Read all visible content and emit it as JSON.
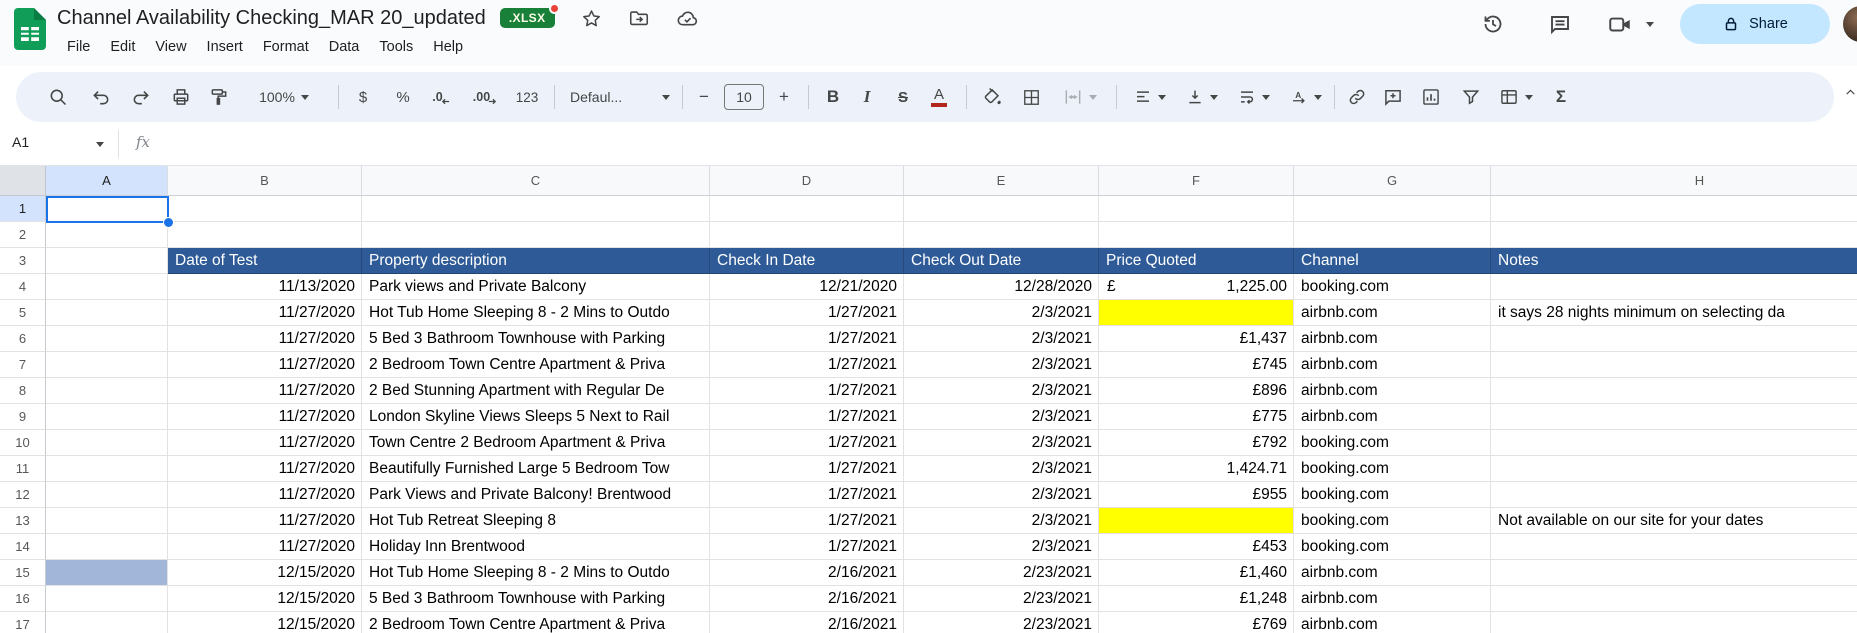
{
  "app": {
    "title": "Channel Availability Checking_MAR 20_updated",
    "file_badge": ".XLSX",
    "menu_items": [
      "File",
      "Edit",
      "View",
      "Insert",
      "Format",
      "Data",
      "Tools",
      "Help"
    ],
    "share_button": "Share"
  },
  "toolbar": {
    "zoom_value": "100%",
    "currency_label": "$",
    "percent_label": "%",
    "decimal_decrease_label": ".0",
    "decimal_increase_label": ".00",
    "plain_format_label": "123",
    "font_family_value": "Defaul...",
    "minus_label": "−",
    "font_size_value": "10",
    "plus_label": "+",
    "bold_label": "B",
    "italic_label": "I",
    "strikethrough_label": "S",
    "text_color_label": "A",
    "functions_label": "Σ",
    "collapse_label": "^"
  },
  "formula_bar": {
    "cell_reference": "A1",
    "fx_label": "fx"
  },
  "grid": {
    "column_letters": [
      "A",
      "B",
      "C",
      "D",
      "E",
      "F",
      "G",
      "H"
    ],
    "selected_cell": "A1",
    "selected_column": "A",
    "selected_row": 1,
    "visible_row_count": 17
  },
  "sheet_table": {
    "header_row_number": 3,
    "headers_by_col": {
      "B": "Date of Test",
      "C": "Property description",
      "D": "Check In Date",
      "E": "Check Out Date",
      "F": "Price Quoted",
      "G": "Channel",
      "H": "Notes"
    },
    "rows": [
      {
        "n": 4,
        "date": "11/13/2020",
        "property": "Park views and Private Balcony",
        "check_in": "12/21/2020",
        "check_out": "12/28/2020",
        "price": "1,225.00",
        "price_style": "accounting",
        "currency": "£",
        "channel": "booking.com",
        "notes": ""
      },
      {
        "n": 5,
        "date": "11/27/2020",
        "property": "Hot Tub Home Sleeping 8 - 2 Mins to Outdo",
        "check_in": "1/27/2021",
        "check_out": "2/3/2021",
        "price": "",
        "price_style": "highlight",
        "channel": "airbnb.com",
        "notes": "it says 28 nights minimum on selecting da"
      },
      {
        "n": 6,
        "date": "11/27/2020",
        "property": "5 Bed 3 Bathroom Townhouse with Parking",
        "check_in": "1/27/2021",
        "check_out": "2/3/2021",
        "price": "£1,437",
        "price_style": "plain",
        "channel": "airbnb.com",
        "notes": ""
      },
      {
        "n": 7,
        "date": "11/27/2020",
        "property": "2 Bedroom Town Centre Apartment & Priva",
        "check_in": "1/27/2021",
        "check_out": "2/3/2021",
        "price": "£745",
        "price_style": "plain",
        "channel": "airbnb.com",
        "notes": ""
      },
      {
        "n": 8,
        "date": "11/27/2020",
        "property": "2 Bed Stunning Apartment with Regular De",
        "check_in": "1/27/2021",
        "check_out": "2/3/2021",
        "price": "£896",
        "price_style": "plain",
        "channel": "airbnb.com",
        "notes": ""
      },
      {
        "n": 9,
        "date": "11/27/2020",
        "property": "London Skyline Views Sleeps 5 Next to Rail",
        "check_in": "1/27/2021",
        "check_out": "2/3/2021",
        "price": "£775",
        "price_style": "plain",
        "channel": "airbnb.com",
        "notes": ""
      },
      {
        "n": 10,
        "date": "11/27/2020",
        "property": "Town Centre 2 Bedroom Apartment & Priva",
        "check_in": "1/27/2021",
        "check_out": "2/3/2021",
        "price": "£792",
        "price_style": "plain",
        "channel": "booking.com",
        "notes": ""
      },
      {
        "n": 11,
        "date": "11/27/2020",
        "property": "Beautifully Furnished Large 5 Bedroom Tow",
        "check_in": "1/27/2021",
        "check_out": "2/3/2021",
        "price": "1,424.71",
        "price_style": "plain",
        "channel": "booking.com",
        "notes": ""
      },
      {
        "n": 12,
        "date": "11/27/2020",
        "property": "Park Views and Private Balcony! Brentwood",
        "check_in": "1/27/2021",
        "check_out": "2/3/2021",
        "price": "£955",
        "price_style": "plain",
        "channel": "booking.com",
        "notes": ""
      },
      {
        "n": 13,
        "date": "11/27/2020",
        "property": "Hot Tub Retreat Sleeping 8",
        "check_in": "1/27/2021",
        "check_out": "2/3/2021",
        "price": "",
        "price_style": "highlight",
        "channel": "booking.com",
        "notes": "Not available on our site for your dates"
      },
      {
        "n": 14,
        "date": "11/27/2020",
        "property": "Holiday Inn Brentwood",
        "check_in": "1/27/2021",
        "check_out": "2/3/2021",
        "price": "£453",
        "price_style": "plain",
        "channel": "booking.com",
        "notes": ""
      },
      {
        "n": 15,
        "date": "12/15/2020",
        "property": "Hot Tub Home Sleeping 8 - 2 Mins to Outdo",
        "check_in": "2/16/2021",
        "check_out": "2/23/2021",
        "price": "£1,460",
        "price_style": "plain",
        "channel": "airbnb.com",
        "notes": "",
        "a_cell_fill": true
      },
      {
        "n": 16,
        "date": "12/15/2020",
        "property": "5 Bed 3 Bathroom Townhouse with Parking",
        "check_in": "2/16/2021",
        "check_out": "2/23/2021",
        "price": "£1,248",
        "price_style": "plain",
        "channel": "airbnb.com",
        "notes": ""
      },
      {
        "n": 17,
        "date": "12/15/2020",
        "property": "2 Bedroom Town Centre Apartment & Priva",
        "check_in": "2/16/2021",
        "check_out": "2/23/2021",
        "price": "£769",
        "price_style": "plain",
        "channel": "airbnb.com",
        "notes": ""
      }
    ]
  },
  "colors": {
    "accent": "#1a73e8",
    "header_blue": "#2e5b97",
    "highlight_yellow": "#ffff00",
    "row15_a_fill": "#a2b6da",
    "share_bg": "#c2e7ff",
    "badge_green": "#188038",
    "notification_red": "#ea4335"
  }
}
